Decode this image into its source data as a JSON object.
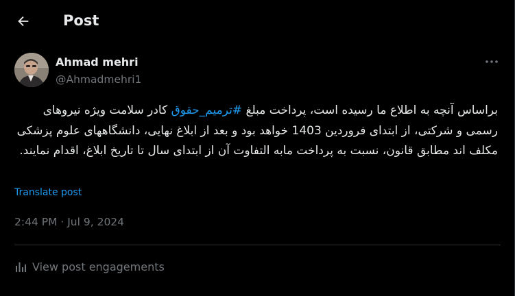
{
  "header": {
    "title": "Post",
    "back_icon": "arrow-left-icon"
  },
  "author": {
    "name": "Ahmad mehri",
    "handle": "@Ahmadmehri1",
    "avatar_icon": "avatar-photo"
  },
  "more_icon": "more-horizontal-icon",
  "tweet": {
    "text_before": "براساس آنچه به اطلاع ما رسیده است، پرداخت مبلغ ",
    "hashtag": "#ترمیم_حقوق",
    "text_after": " کادر سلامت ویژه نیروهای رسمی و شرکتی، از ابتدای فروردین 1403 خواهد بود و بعد از ابلاغ نهایی، دانشگاههای علوم پزشکی مکلف اند مطابق قانون، نسبت به پرداخت مابه التفاوت آن از ابتدای سال تا تاریخ ابلاغ، اقدام نمایند."
  },
  "translate_label": "Translate post",
  "timestamp": "2:44 PM · Jul 9, 2024",
  "engagements": {
    "label": "View post engagements",
    "icon": "bar-chart-icon"
  },
  "colors": {
    "background": "#000000",
    "text": "#e7e9ea",
    "muted": "#71767b",
    "accent": "#1d9bf0",
    "border": "#2f3336"
  }
}
